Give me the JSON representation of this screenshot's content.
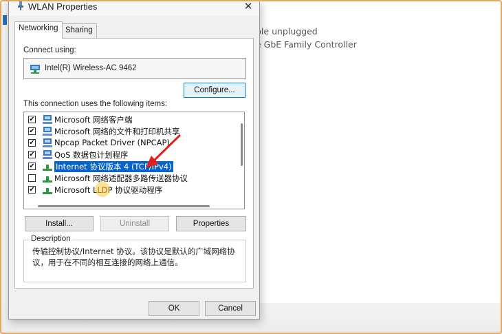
{
  "window": {
    "title": "WLAN Properties",
    "close_glyph": "✕"
  },
  "tabs": [
    {
      "label": "Networking"
    },
    {
      "label": "Sharing"
    }
  ],
  "connect": {
    "label": "Connect using:",
    "adapter": "Intel(R) Wireless-AC 9462",
    "configure_label": "Configure..."
  },
  "items": {
    "label": "This connection uses the following items:",
    "rows": [
      {
        "text": "Microsoft 网络客户端",
        "checked": true
      },
      {
        "text": "Microsoft 网络的文件和打印机共享",
        "checked": true
      },
      {
        "text": "Npcap Packet Driver (NPCAP)",
        "checked": true
      },
      {
        "text": "QoS 数据包计划程序",
        "checked": true
      },
      {
        "text": "Internet 协议版本 4 (TCP/IPv4)",
        "checked": true,
        "selected": true
      },
      {
        "text": "Microsoft 网络适配器多路传送器协议",
        "checked": false
      },
      {
        "text": "Microsoft LLDP 协议驱动程序",
        "checked": true
      }
    ]
  },
  "actions": {
    "install": "Install...",
    "uninstall": "Uninstall",
    "properties": "Properties"
  },
  "description": {
    "title": "Description",
    "text": "传输控制协议/Internet 协议。该协议是默认的广域网络协议，用于在不同的相互连接的网络上通信。"
  },
  "footer": {
    "ok": "OK",
    "cancel": "Cancel"
  },
  "background": {
    "line1": "ble unplugged",
    "line2": "e GbE Family Controller"
  },
  "colors": {
    "selection": "#0a64c8",
    "arrow": "#e02020",
    "frame": "#e7a65a"
  },
  "icons": {
    "checkmark": "✔"
  }
}
